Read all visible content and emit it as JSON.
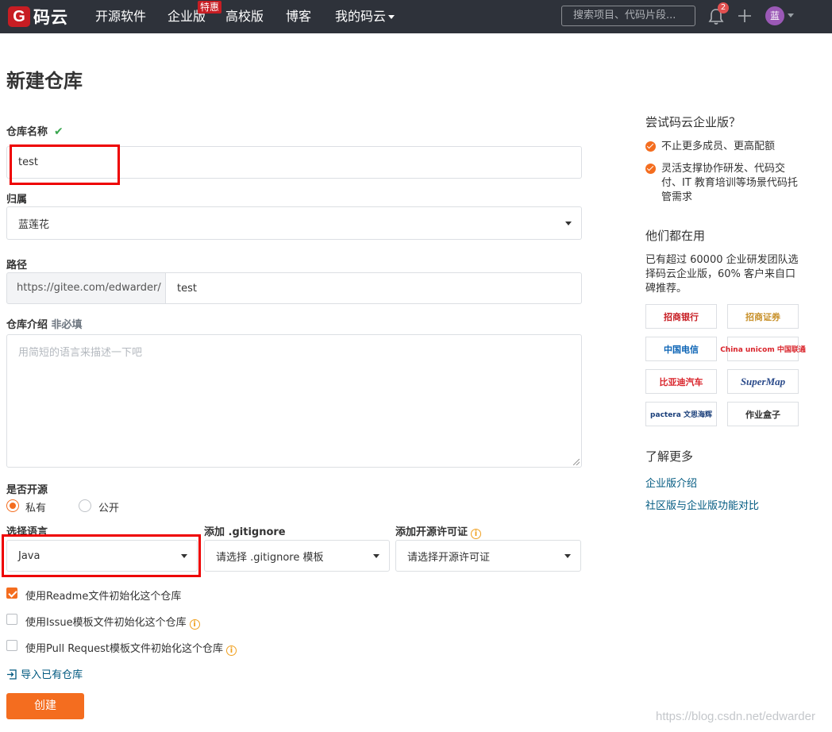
{
  "nav": {
    "logo_mark": "G",
    "logo_text": "码云",
    "items": [
      "开源软件",
      "企业版",
      "高校版",
      "博客",
      "我的码云"
    ],
    "enterprise_badge": "特惠",
    "search_placeholder": "搜索项目、代码片段...",
    "notification_count": "2",
    "avatar_text": "蓝"
  },
  "form": {
    "title": "新建仓库",
    "name_label": "仓库名称",
    "name_value": "test",
    "owner_label": "归属",
    "owner_value": "蓝莲花",
    "path_label": "路径",
    "path_prefix": "https://gitee.com/edwarder/",
    "path_value": "test",
    "desc_label": "仓库介绍",
    "desc_optional": "非必填",
    "desc_placeholder": "用简短的语言来描述一下吧",
    "open_label": "是否开源",
    "visibility_private": "私有",
    "visibility_public": "公开",
    "language_label": "选择语言",
    "language_value": "Java",
    "gitignore_label": "添加 .gitignore",
    "gitignore_value": "请选择 .gitignore 模板",
    "license_label": "添加开源许可证",
    "license_value": "请选择开源许可证",
    "opt_readme": "使用Readme文件初始化这个仓库",
    "opt_issue": "使用Issue模板文件初始化这个仓库",
    "opt_pr": "使用Pull Request模板文件初始化这个仓库",
    "import_link": "导入已有仓库",
    "create_button": "创建"
  },
  "sidebar": {
    "try_heading": "尝试码云企业版？",
    "benefit_1": "不止更多成员、更高配额",
    "benefit_2": "灵活支撑协作研发、代码交付、IT 教育培训等场景代码托管需求",
    "users_heading": "他们都在用",
    "users_text": "已有超过 60000 企业研发团队选择码云企业版，60% 客户来自口碑推荐。",
    "logos": [
      "招商银行",
      "招商证券",
      "中国电信",
      "China unicom 中国联通",
      "比亚迪汽车",
      "SuperMap",
      "pactera 文思海辉",
      "作业盒子"
    ],
    "more_heading": "了解更多",
    "link_1": "企业版介绍",
    "link_2": "社区版与企业版功能对比"
  },
  "watermark": "https://blog.csdn.net/edwarder",
  "colors": {
    "accent": "#f46d1f",
    "nav_bg": "#2e323a",
    "brand_red": "#c71d23",
    "link": "#005980"
  }
}
